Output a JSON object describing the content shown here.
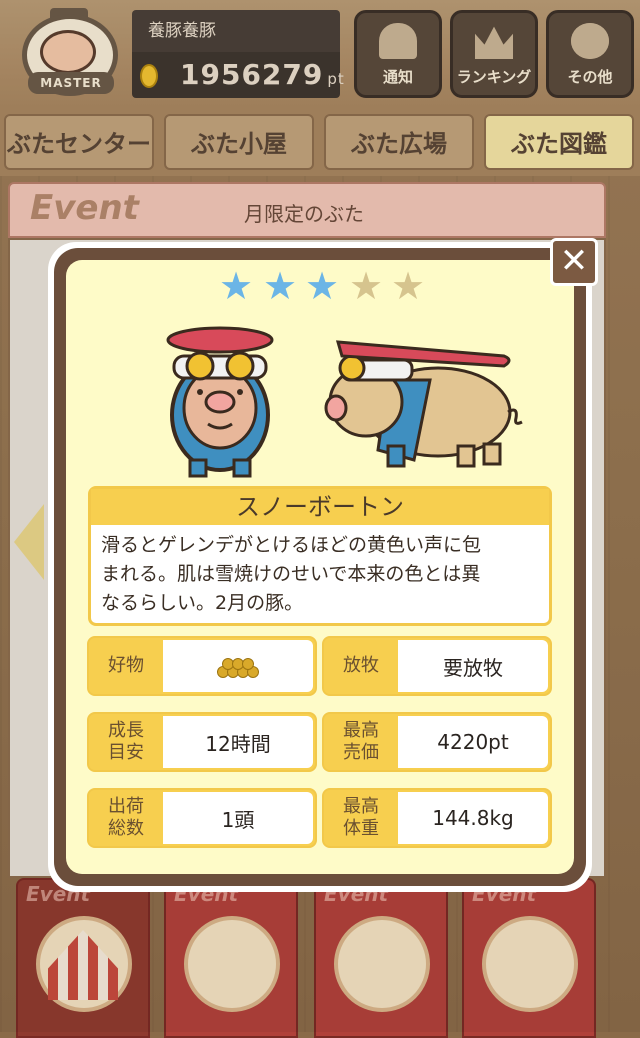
{
  "header": {
    "username": "養豚養豚",
    "points": "1956279",
    "points_unit": "pt",
    "avatar_banner": "MASTER",
    "buttons": [
      {
        "label": "通知",
        "icon": "bell-icon"
      },
      {
        "label": "ランキング",
        "icon": "crown-icon"
      },
      {
        "label": "その他",
        "icon": "gear-icon"
      }
    ]
  },
  "tabs": [
    {
      "label": "ぶたセンター",
      "active": false
    },
    {
      "label": "ぶた小屋",
      "active": false
    },
    {
      "label": "ぶた広場",
      "active": false
    },
    {
      "label": "ぶた図鑑",
      "active": true
    }
  ],
  "event_panel": {
    "logo": "Event",
    "title": "月限定のぶた"
  },
  "bottom_cards": [
    {
      "label": "Event",
      "icon": "circus-tent-icon"
    },
    {
      "label": "Event",
      "icon": "pig-wreath-icon"
    },
    {
      "label": "Event",
      "icon": "calendar-icon"
    },
    {
      "label": "Event",
      "icon": "pig-family-icon"
    }
  ],
  "modal": {
    "close_label": "✕",
    "rating": 3,
    "max_rating": 5,
    "pig_name": "スノーボートン",
    "description_lines": [
      "滑るとゲレンデがとけるほどの黄色い声に包",
      "まれる。肌は雪焼けのせいで本来の色とは異",
      "なるらしい。2月の豚。"
    ],
    "stats": {
      "favorite_food": {
        "key": "好物",
        "value_icon": "grain-icon"
      },
      "grazing": {
        "key": "放牧",
        "value": "要放牧"
      },
      "growth": {
        "key_line1": "成長",
        "key_line2": "目安",
        "value": "12時間"
      },
      "max_price": {
        "key_line1": "最高",
        "key_line2": "売価",
        "value": "4220pt"
      },
      "shipped": {
        "key_line1": "出荷",
        "key_line2": "総数",
        "value": "1頭"
      },
      "max_weight": {
        "key_line1": "最高",
        "key_line2": "体重",
        "value": "144.8kg"
      }
    }
  },
  "colors": {
    "modal_bg": "#fefbc8",
    "modal_frame": "#6b4e3b",
    "accent_yellow": "#f7cf4f",
    "star_on": "#6bb5e6",
    "star_off": "#d6c48e"
  }
}
